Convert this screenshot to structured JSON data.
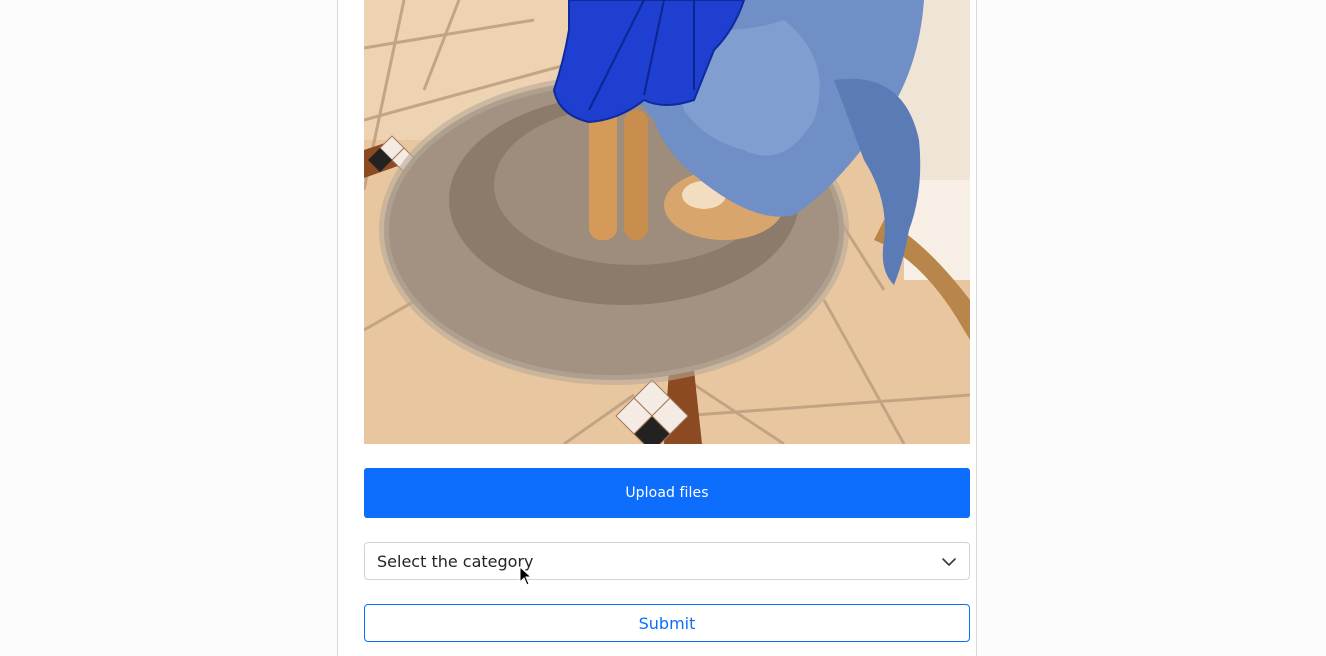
{
  "form": {
    "photo_alt": "Dog wearing a blue dragon costume sitting on a round plush pet bed",
    "upload_label": "Upload files",
    "category_select_value": "Select the category",
    "submit_label": "Submit"
  },
  "colors": {
    "primary": "#0d6efd",
    "page_background": "#fcfcfc",
    "card_border": "#d8d8d8"
  },
  "icons": {
    "select_indicator": "chevron-down-icon",
    "pointer": "mouse-cursor-icon"
  }
}
